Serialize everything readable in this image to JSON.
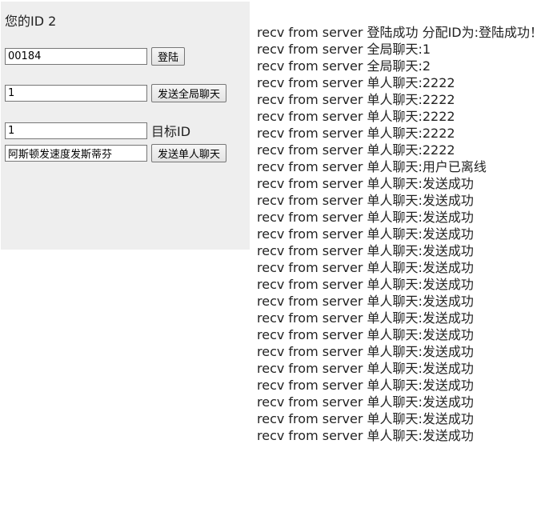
{
  "panel": {
    "id_label": "您的ID 2",
    "login": {
      "value": "00184",
      "button": "登陆"
    },
    "global": {
      "value": "1",
      "button": "发送全局聊天"
    },
    "target": {
      "value": "1",
      "label": "目标ID"
    },
    "single": {
      "value": "阿斯顿发速度发斯蒂芬",
      "button": "发送单人聊天"
    }
  },
  "log": [
    "recv from server 登陆成功 分配ID为:登陆成功！",
    "recv from server 全局聊天:1",
    "recv from server 全局聊天:2",
    "recv from server 单人聊天:2222",
    "recv from server 单人聊天:2222",
    "recv from server 单人聊天:2222",
    "recv from server 单人聊天:2222",
    "recv from server 单人聊天:2222",
    "recv from server 单人聊天:用户已离线",
    "recv from server 单人聊天:发送成功",
    "recv from server 单人聊天:发送成功",
    "recv from server 单人聊天:发送成功",
    "recv from server 单人聊天:发送成功",
    "recv from server 单人聊天:发送成功",
    "recv from server 单人聊天:发送成功",
    "recv from server 单人聊天:发送成功",
    "recv from server 单人聊天:发送成功",
    "recv from server 单人聊天:发送成功",
    "recv from server 单人聊天:发送成功",
    "recv from server 单人聊天:发送成功",
    "recv from server 单人聊天:发送成功",
    "recv from server 单人聊天:发送成功",
    "recv from server 单人聊天:发送成功",
    "recv from server 单人聊天:发送成功",
    "recv from server 单人聊天:发送成功"
  ]
}
